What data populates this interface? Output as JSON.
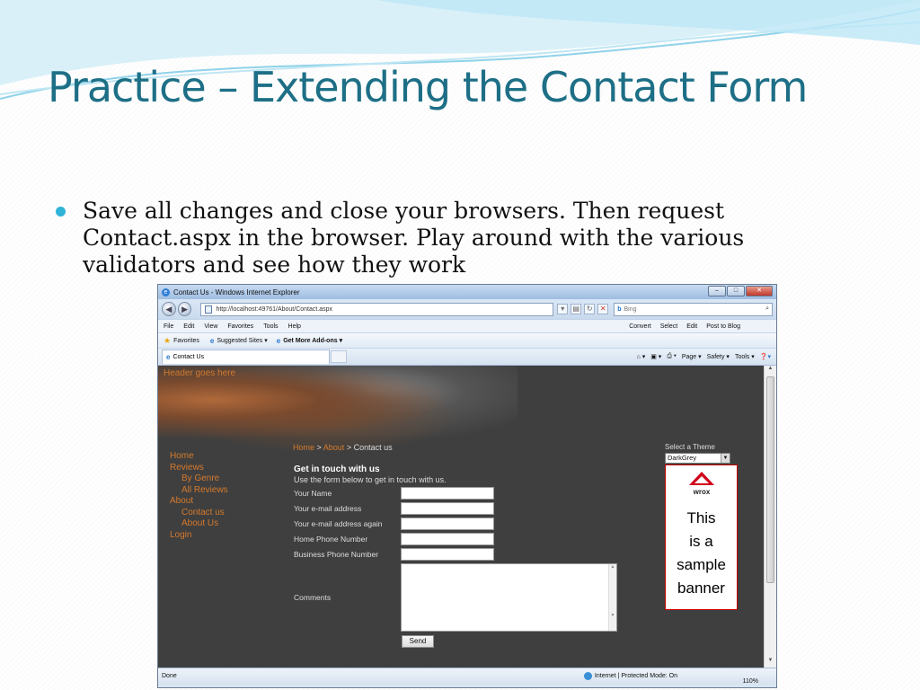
{
  "slide": {
    "title": "Practice – Extending the Contact Form",
    "bullet": "Save all changes and close your browsers. Then request Contact.aspx in the browser. Play around with the various validators and see how they work",
    "accent_color": "#1d6f86",
    "bullet_color": "#2fb3d8"
  },
  "browser": {
    "window_title": "Contact Us - Windows Internet Explorer",
    "address": "http://localhost:49761/About/Contact.aspx",
    "search_placeholder": "Bing",
    "menu": [
      "File",
      "Edit",
      "View",
      "Favorites",
      "Tools",
      "Help"
    ],
    "menu_right": [
      "Convert",
      "Select",
      "Edit",
      "Post to Blog"
    ],
    "favorites_label": "Favorites",
    "fav_links": [
      "Suggested Sites ▾",
      "Get More Add-ons ▾"
    ],
    "tab_title": "Contact Us",
    "commands": [
      "Page ▾",
      "Safety ▾",
      "Tools ▾"
    ],
    "status_left": "Done",
    "status_zone": "Internet | Protected Mode: On",
    "zoom": "110%"
  },
  "page": {
    "header_text": "Header goes here",
    "menu": {
      "home": "Home",
      "reviews": "Reviews",
      "by_genre": "By Genre",
      "all_reviews": "All Reviews",
      "about": "About",
      "contact_us": "Contact us",
      "about_us": "About Us",
      "login": "Login"
    },
    "breadcrumb": {
      "home": "Home",
      "sep": " > ",
      "about": "About",
      "current": "Contact us"
    },
    "heading": "Get in touch with us",
    "intro": "Use the form below to get in touch with us.",
    "fields": {
      "name": "Your Name",
      "email": "Your e-mail address",
      "email_again": "Your e-mail address again",
      "home_phone": "Home Phone Number",
      "business_phone": "Business Phone Number",
      "comments": "Comments"
    },
    "send": "Send",
    "theme_label": "Select a Theme",
    "theme_value": "DarkGrey",
    "banner_logo": "wrox",
    "banner_lines": [
      "This",
      "is a",
      "sample",
      "banner"
    ]
  }
}
